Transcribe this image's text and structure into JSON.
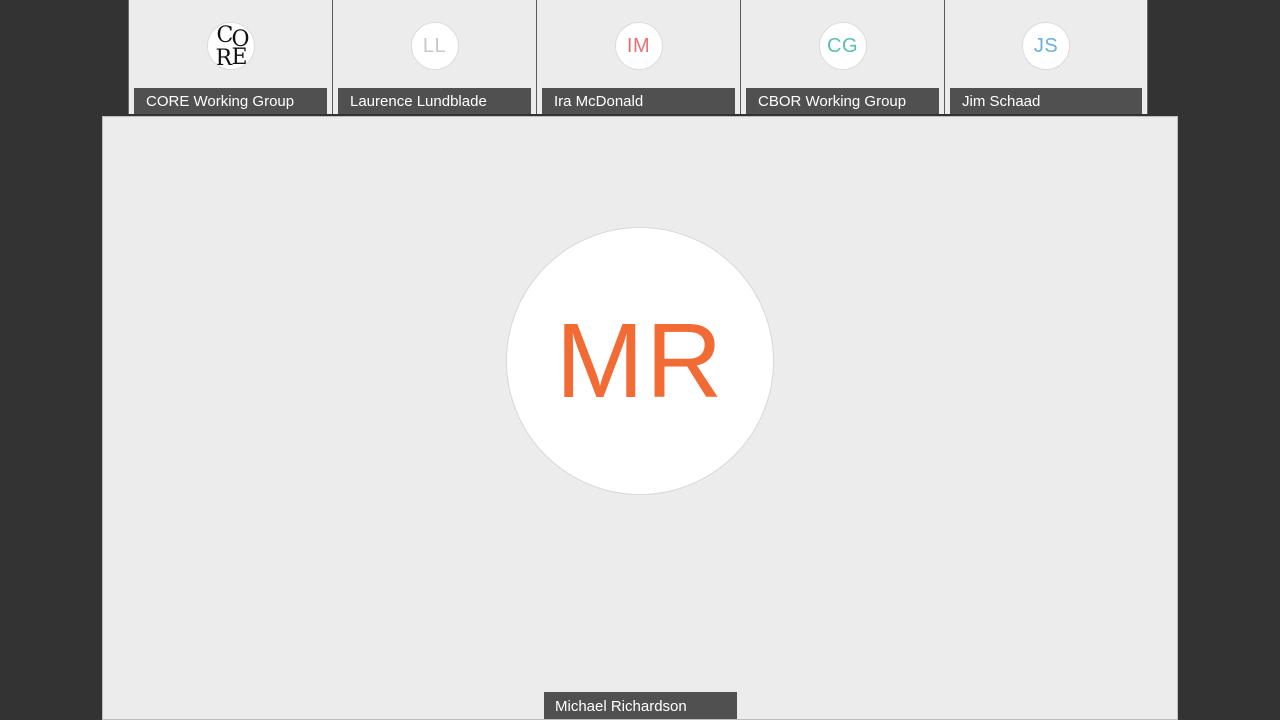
{
  "participants": [
    {
      "name": "CORE Working Group",
      "logo_text": [
        "C",
        "O",
        "R",
        "E"
      ],
      "type": "logo"
    },
    {
      "name": "Laurence Lundblade",
      "initials": "LL",
      "color": "#c8c8c8",
      "type": "initials"
    },
    {
      "name": "Ira McDonald",
      "initials": "IM",
      "color": "#e57373",
      "type": "initials"
    },
    {
      "name": "CBOR Working Group",
      "initials": "CG",
      "color": "#5cbfad",
      "type": "initials"
    },
    {
      "name": "Jim Schaad",
      "initials": "JS",
      "color": "#6ab0d8",
      "type": "initials"
    }
  ],
  "active_speaker": {
    "name": "Michael Richardson",
    "initials": "MR",
    "color": "#f26a34"
  }
}
